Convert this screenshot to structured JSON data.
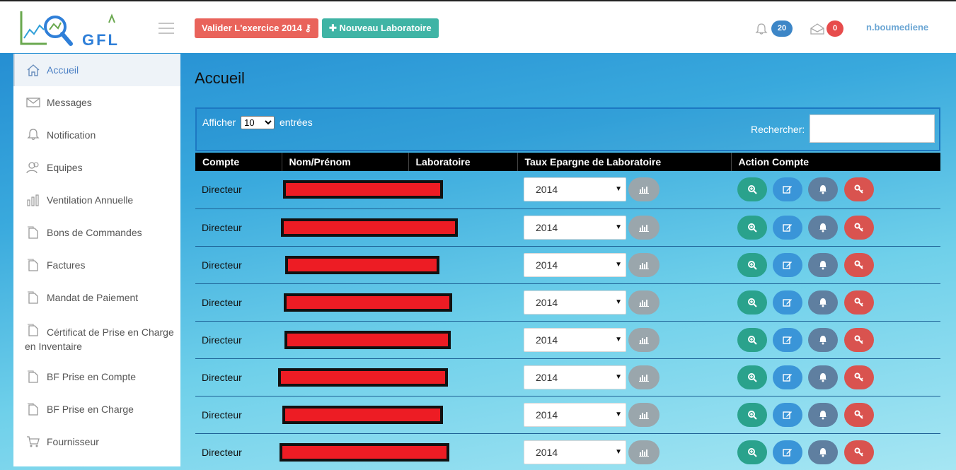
{
  "header": {
    "logo_text": "GFL",
    "validate_button": "Valider L'exercice 2014",
    "new_lab_button": "Nouveau Laboratoire",
    "notif_count": "20",
    "mail_count": "0",
    "username": "n.boumediene"
  },
  "sidebar": {
    "items": [
      {
        "label": "Accueil",
        "icon": "home-icon"
      },
      {
        "label": "Messages",
        "icon": "envelope-icon"
      },
      {
        "label": "Notification",
        "icon": "bell-icon"
      },
      {
        "label": "Equipes",
        "icon": "users-icon"
      },
      {
        "label": "Ventilation Annuelle",
        "icon": "bar-chart-icon"
      },
      {
        "label": "Bons de Commandes",
        "icon": "document-icon"
      },
      {
        "label": "Factures",
        "icon": "document-icon"
      },
      {
        "label": "Mandat de Paiement",
        "icon": "document-icon"
      },
      {
        "label": "Cértificat de Prise en Charge en Inventaire",
        "icon": "document-icon"
      },
      {
        "label": "BF Prise en Compte",
        "icon": "document-icon"
      },
      {
        "label": "BF Prise en Charge",
        "icon": "document-icon"
      },
      {
        "label": "Fournisseur",
        "icon": "cart-icon"
      }
    ]
  },
  "main": {
    "title": "Accueil",
    "show_label_before": "Afficher",
    "show_value": "10",
    "show_label_after": "entrées",
    "search_label": "Rechercher:",
    "search_value": ""
  },
  "table": {
    "columns": [
      "Compte",
      "Nom/Prénom",
      "Laboratoire",
      "Taux Epargne de Laboratoire",
      "Action Compte"
    ],
    "rows": [
      {
        "compte": "Directeur",
        "year": "2014"
      },
      {
        "compte": "Directeur",
        "year": "2014"
      },
      {
        "compte": "Directeur",
        "year": "2014"
      },
      {
        "compte": "Directeur",
        "year": "2014"
      },
      {
        "compte": "Directeur",
        "year": "2014"
      },
      {
        "compte": "Directeur",
        "year": "2014"
      },
      {
        "compte": "Directeur",
        "year": "2014"
      },
      {
        "compte": "Directeur",
        "year": "2014"
      }
    ]
  },
  "colors": {
    "validate": "#e9635b",
    "new_lab": "#3fb4a5",
    "view": "#2aa28c",
    "edit": "#3a95d8",
    "notify": "#5f7fa0",
    "key": "#d9534f",
    "redaction": "#ed1c24"
  }
}
